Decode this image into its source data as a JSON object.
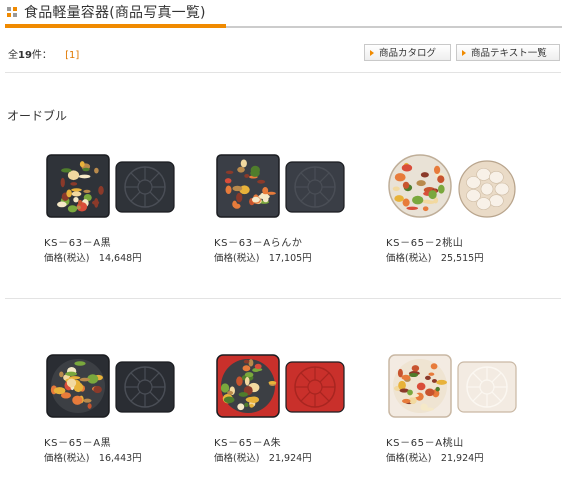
{
  "header": {
    "title": "食品軽量容器(商品写真一覧)"
  },
  "count": {
    "prefix": "全",
    "number": "19",
    "suffix": "件：",
    "page": "[1]"
  },
  "buttons": {
    "catalog": "商品カタログ",
    "textlist": "商品テキスト一覧"
  },
  "section": {
    "title": "オードブル"
  },
  "colors": {
    "accent": "#f08a00",
    "separator": "#e3e3e3"
  },
  "products": [
    {
      "name": "KS－63－A黒",
      "price": "価格(税込)　14,648円",
      "tray_color": "#2f3339",
      "style": "square-black"
    },
    {
      "name": "KS－63－Aらんか",
      "price": "価格(税込)　17,105円",
      "tray_color": "#3a3e46",
      "style": "square-black"
    },
    {
      "name": "KS－65－2桃山",
      "price": "価格(税込)　25,515円",
      "tray_color": "#f2e6d8",
      "style": "round-ivory"
    },
    {
      "name": "KS－65－A黒",
      "price": "価格(税込)　16,443円",
      "tray_color": "#2a2d33",
      "style": "octa-black"
    },
    {
      "name": "KS－65－A朱",
      "price": "価格(税込)　21,924円",
      "tray_color": "#c9302b",
      "style": "octa-red"
    },
    {
      "name": "KS－65－A桃山",
      "price": "価格(税込)　21,924円",
      "tray_color": "#f3ebe2",
      "style": "octa-ivory"
    }
  ]
}
